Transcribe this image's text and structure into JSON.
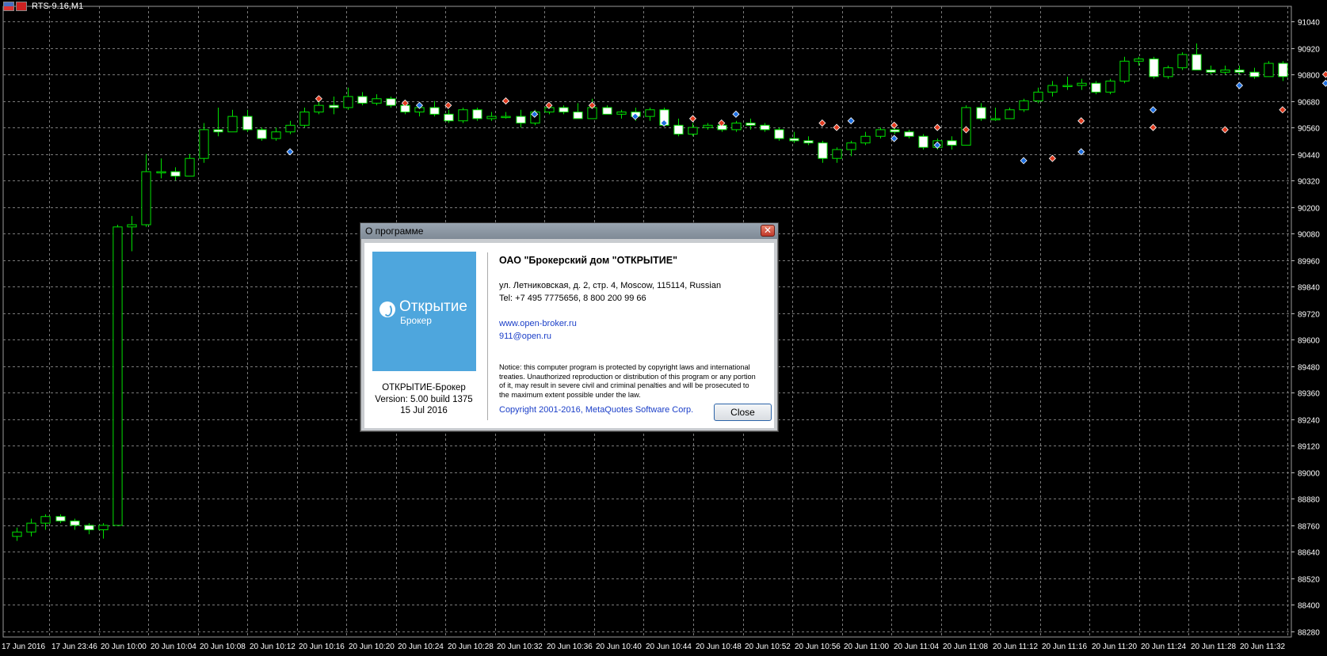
{
  "chart_window": {
    "title": "RTS-9.16,M1",
    "colors": {
      "background": "#000000",
      "grid": "#7a7a7a",
      "bull": "#00e000",
      "bear_body": "#ffffff",
      "axis_text": "#ffffff",
      "marker_sell": "#e03a1e",
      "marker_buy": "#1e6fe0"
    }
  },
  "chart_data": {
    "type": "candlestick",
    "y_ticks": [
      91040,
      90920,
      90800,
      90680,
      90560,
      90440,
      90320,
      90200,
      90080,
      89960,
      89840,
      89720,
      89600,
      89480,
      89360,
      89240,
      89120,
      89000,
      88880,
      88760,
      88640,
      88520,
      88400,
      88280
    ],
    "x_ticks": [
      "17 Jun 2016",
      "17 Jun 23:46",
      "20 Jun 10:00",
      "20 Jun 10:04",
      "20 Jun 10:08",
      "20 Jun 10:12",
      "20 Jun 10:16",
      "20 Jun 10:20",
      "20 Jun 10:24",
      "20 Jun 10:28",
      "20 Jun 10:32",
      "20 Jun 10:36",
      "20 Jun 10:40",
      "20 Jun 10:44",
      "20 Jun 10:48",
      "20 Jun 10:52",
      "20 Jun 10:56",
      "20 Jun 11:00",
      "20 Jun 11:04",
      "20 Jun 11:08",
      "20 Jun 11:12",
      "20 Jun 11:16",
      "20 Jun 11:20",
      "20 Jun 11:24",
      "20 Jun 11:28",
      "20 Jun 11:32"
    ],
    "ylim": [
      88280,
      91040
    ],
    "grid": true,
    "candles": [
      [
        88710,
        88750,
        88690,
        88730
      ],
      [
        88730,
        88790,
        88710,
        88770
      ],
      [
        88770,
        88810,
        88740,
        88800
      ],
      [
        88800,
        88810,
        88770,
        88780
      ],
      [
        88780,
        88790,
        88740,
        88760
      ],
      [
        88760,
        88770,
        88720,
        88740
      ],
      [
        88740,
        88770,
        88700,
        88760
      ],
      [
        88760,
        90120,
        88760,
        90110
      ],
      [
        90110,
        90160,
        90000,
        90120
      ],
      [
        90120,
        90440,
        90110,
        90360
      ],
      [
        90360,
        90420,
        90330,
        90360
      ],
      [
        90360,
        90380,
        90320,
        90340
      ],
      [
        90340,
        90440,
        90340,
        90420
      ],
      [
        90420,
        90580,
        90400,
        90550
      ],
      [
        90550,
        90650,
        90520,
        90540
      ],
      [
        90540,
        90640,
        90540,
        90610
      ],
      [
        90610,
        90640,
        90540,
        90550
      ],
      [
        90550,
        90560,
        90500,
        90510
      ],
      [
        90510,
        90560,
        90500,
        90540
      ],
      [
        90540,
        90590,
        90530,
        90570
      ],
      [
        90570,
        90650,
        90560,
        90630
      ],
      [
        90630,
        90690,
        90620,
        90660
      ],
      [
        90660,
        90700,
        90620,
        90650
      ],
      [
        90650,
        90740,
        90640,
        90700
      ],
      [
        90700,
        90720,
        90660,
        90670
      ],
      [
        90670,
        90710,
        90660,
        90690
      ],
      [
        90690,
        90700,
        90650,
        90660
      ],
      [
        90660,
        90670,
        90620,
        90630
      ],
      [
        90630,
        90660,
        90610,
        90650
      ],
      [
        90650,
        90680,
        90610,
        90620
      ],
      [
        90620,
        90640,
        90580,
        90590
      ],
      [
        90590,
        90650,
        90580,
        90640
      ],
      [
        90640,
        90650,
        90590,
        90600
      ],
      [
        90600,
        90630,
        90590,
        90610
      ],
      [
        90610,
        90630,
        90600,
        90610
      ],
      [
        90610,
        90640,
        90560,
        90580
      ],
      [
        90580,
        90640,
        90570,
        90630
      ],
      [
        90630,
        90670,
        90620,
        90650
      ],
      [
        90650,
        90660,
        90620,
        90630
      ],
      [
        90630,
        90670,
        90600,
        90600
      ],
      [
        90600,
        90690,
        90600,
        90650
      ],
      [
        90650,
        90660,
        90620,
        90620
      ],
      [
        90620,
        90640,
        90600,
        90630
      ],
      [
        90630,
        90650,
        90590,
        90610
      ],
      [
        90610,
        90650,
        90590,
        90640
      ],
      [
        90640,
        90650,
        90570,
        90570
      ],
      [
        90570,
        90600,
        90520,
        90530
      ],
      [
        90530,
        90580,
        90520,
        90560
      ],
      [
        90560,
        90580,
        90550,
        90570
      ],
      [
        90570,
        90590,
        90540,
        90550
      ],
      [
        90550,
        90590,
        90540,
        90580
      ],
      [
        90580,
        90600,
        90550,
        90570
      ],
      [
        90570,
        90580,
        90540,
        90550
      ],
      [
        90550,
        90560,
        90500,
        90510
      ],
      [
        90510,
        90540,
        90490,
        90500
      ],
      [
        90500,
        90520,
        90480,
        90490
      ],
      [
        90490,
        90500,
        90400,
        90420
      ],
      [
        90420,
        90470,
        90400,
        90460
      ],
      [
        90460,
        90500,
        90430,
        90490
      ],
      [
        90490,
        90540,
        90480,
        90520
      ],
      [
        90520,
        90560,
        90510,
        90550
      ],
      [
        90550,
        90570,
        90530,
        90540
      ],
      [
        90540,
        90550,
        90510,
        90520
      ],
      [
        90520,
        90530,
        90460,
        90470
      ],
      [
        90470,
        90510,
        90460,
        90500
      ],
      [
        90500,
        90520,
        90460,
        90480
      ],
      [
        90480,
        90660,
        90480,
        90650
      ],
      [
        90650,
        90670,
        90590,
        90600
      ],
      [
        90600,
        90650,
        90590,
        90600
      ],
      [
        90600,
        90650,
        90600,
        90640
      ],
      [
        90640,
        90690,
        90630,
        90680
      ],
      [
        90680,
        90740,
        90670,
        90720
      ],
      [
        90720,
        90770,
        90700,
        90750
      ],
      [
        90750,
        90790,
        90730,
        90750
      ],
      [
        90750,
        90780,
        90730,
        90760
      ],
      [
        90760,
        90770,
        90710,
        90720
      ],
      [
        90720,
        90780,
        90710,
        90770
      ],
      [
        90770,
        90880,
        90760,
        90860
      ],
      [
        90860,
        90880,
        90840,
        90870
      ],
      [
        90870,
        90880,
        90780,
        90790
      ],
      [
        90790,
        90840,
        90780,
        90830
      ],
      [
        90830,
        90900,
        90820,
        90890
      ],
      [
        90890,
        90940,
        90840,
        90820
      ],
      [
        90820,
        90840,
        90800,
        90810
      ],
      [
        90810,
        90840,
        90800,
        90820
      ],
      [
        90820,
        90840,
        90800,
        90810
      ],
      [
        90810,
        90830,
        90780,
        90790
      ],
      [
        90790,
        90860,
        90790,
        90850
      ],
      [
        90850,
        90860,
        90770,
        90790
      ]
    ],
    "sell_markers": [
      [
        21,
        90690
      ],
      [
        27,
        90670
      ],
      [
        30,
        90660
      ],
      [
        34,
        90680
      ],
      [
        37,
        90660
      ],
      [
        40,
        90660
      ],
      [
        47,
        90600
      ],
      [
        49,
        90580
      ],
      [
        56,
        90580
      ],
      [
        57,
        90560
      ],
      [
        61,
        90570
      ],
      [
        64,
        90560
      ],
      [
        66,
        90550
      ],
      [
        72,
        90420
      ],
      [
        74,
        90590
      ],
      [
        79,
        90560
      ],
      [
        84,
        90550
      ],
      [
        88,
        90640
      ],
      [
        91,
        90800
      ],
      [
        92,
        90820
      ],
      [
        96,
        90850
      ],
      [
        100,
        90880
      ],
      [
        101,
        90820
      ],
      [
        102,
        90800
      ],
      [
        104,
        90940
      ],
      [
        106,
        90830
      ],
      [
        110,
        90870
      ],
      [
        112,
        90830
      ],
      [
        119,
        90840
      ],
      [
        123,
        90820
      ],
      [
        127,
        90820
      ],
      [
        134,
        90820
      ],
      [
        142,
        90830
      ],
      [
        150,
        90820
      ],
      [
        158,
        90830
      ],
      [
        166,
        90820
      ]
    ],
    "buy_markers": [
      [
        19,
        90450
      ],
      [
        28,
        90660
      ],
      [
        36,
        90620
      ],
      [
        43,
        90610
      ],
      [
        45,
        90580
      ],
      [
        50,
        90620
      ],
      [
        58,
        90590
      ],
      [
        61,
        90510
      ],
      [
        64,
        90480
      ],
      [
        70,
        90410
      ],
      [
        74,
        90450
      ],
      [
        79,
        90640
      ],
      [
        85,
        90750
      ],
      [
        91,
        90760
      ],
      [
        96,
        90760
      ],
      [
        103,
        90880
      ],
      [
        110,
        90770
      ],
      [
        112,
        90800
      ]
    ]
  },
  "about_dialog": {
    "caption": "О программе",
    "close_x": "✕",
    "logo_name": "Открытие",
    "logo_sub": "Брокер",
    "product_name": "ОТКРЫТИЕ-Брокер",
    "version": "Version: 5.00 build 1375",
    "build_date": "15 Jul 2016",
    "company": "ОАО \"Брокерский дом \"ОТКРЫТИЕ\"",
    "address": "ул. Летниковская, д. 2, стр. 4, Moscow, 115114, Russian",
    "phone": "Tel: +7 495 7775656, 8 800 200 99 66",
    "website": "www.open-broker.ru",
    "email": "911@open.ru",
    "notice": "Notice: this computer program is protected by copyright laws and international treaties. Unauthorized reproduction or distribution of this program or any portion of it, may result in severe civil and criminal penalties and will be prosecuted to the maximum extent possible under the law.",
    "copyright": "Copyright 2001-2016, MetaQuotes Software Corp.",
    "close_button": "Close"
  }
}
